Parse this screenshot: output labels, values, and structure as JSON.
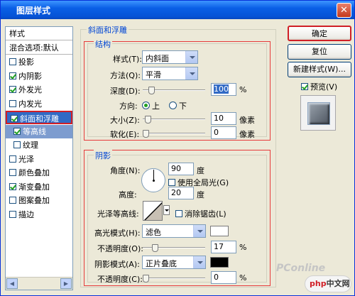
{
  "window": {
    "title": "图层样式",
    "close_glyph": "✕"
  },
  "styles_list": {
    "header": "样式",
    "blend_options": "混合选项:默认",
    "items": [
      {
        "label": "投影",
        "checked": false
      },
      {
        "label": "内阴影",
        "checked": true
      },
      {
        "label": "外发光",
        "checked": true
      },
      {
        "label": "内发光",
        "checked": false
      },
      {
        "label": "斜面和浮雕",
        "checked": true,
        "selected": true
      },
      {
        "label": "等高线",
        "checked": true,
        "sub": true,
        "selected": true
      },
      {
        "label": "纹理",
        "checked": false,
        "sub": true
      },
      {
        "label": "光泽",
        "checked": false
      },
      {
        "label": "颜色叠加",
        "checked": false
      },
      {
        "label": "渐变叠加",
        "checked": true
      },
      {
        "label": "图案叠加",
        "checked": false
      },
      {
        "label": "描边",
        "checked": false
      }
    ]
  },
  "bevel": {
    "group_title": "斜面和浮雕",
    "structure": {
      "title": "结构",
      "style_label": "样式(T):",
      "style_value": "内斜面",
      "method_label": "方法(Q):",
      "method_value": "平滑",
      "depth_label": "深度(D):",
      "depth_value": "100",
      "depth_unit": "%",
      "depth_level": 0.1,
      "direction_label": "方向:",
      "direction_up": "上",
      "direction_down": "下",
      "direction_selected": "up",
      "size_label": "大小(Z):",
      "size_value": "10",
      "size_unit": "像素",
      "size_level": 0.04,
      "soften_label": "软化(E):",
      "soften_value": "0",
      "soften_unit": "像素",
      "soften_level": 0.0
    },
    "shading": {
      "title": "阴影",
      "angle_label": "角度(N):",
      "angle_value": "90",
      "angle_unit": "度",
      "global_light_label": "使用全局光(G)",
      "global_light_checked": false,
      "altitude_label": "高度:",
      "altitude_value": "20",
      "altitude_unit": "度",
      "gloss_label": "光泽等高线:",
      "antialias_label": "消除锯齿(L)",
      "antialias_checked": false,
      "highlight_mode_label": "高光模式(H):",
      "highlight_mode_value": "滤色",
      "highlight_color": "#ffffff",
      "highlight_opacity_label": "不透明度(O):",
      "highlight_opacity_value": "17",
      "highlight_opacity_level": 0.17,
      "shadow_mode_label": "阴影模式(A):",
      "shadow_mode_value": "正片叠底",
      "shadow_color": "#000000",
      "shadow_opacity_label": "不透明度(C):",
      "shadow_opacity_value": "0",
      "shadow_opacity_level": 0.0,
      "opacity_unit": "%"
    }
  },
  "buttons": {
    "ok": "确定",
    "reset": "复位",
    "new_style": "新建样式(W)...",
    "preview_label": "预览(V)",
    "preview_checked": true
  },
  "watermark": {
    "pconline": "PConline",
    "logo": "php",
    "site": "中文网"
  },
  "colors": {
    "accent": "#316ac5",
    "highlight_red": "#e63b3b",
    "legend_blue": "#0046d5",
    "titlebar": "#0553d6"
  }
}
